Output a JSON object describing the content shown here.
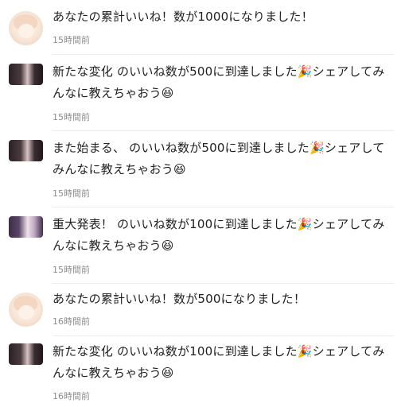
{
  "notifications": [
    {
      "text": "あなたの累計いいね！数が1000になりました！",
      "time": "15時間前"
    },
    {
      "text": "新たな変化 のいいね数が500に到達しました🎉シェアしてみんなに教えちゃおう😆",
      "time": "15時間前"
    },
    {
      "text": "また始まる、 のいいね数が500に到達しました🎉シェアしてみんなに教えちゃおう😆",
      "time": "15時間前"
    },
    {
      "text": "重大発表！ のいいね数が100に到達しました🎉シェアしてみんなに教えちゃおう😆",
      "time": "15時間前"
    },
    {
      "text": "あなたの累計いいね！数が500になりました！",
      "time": "16時間前"
    },
    {
      "text": "新たな変化 のいいね数が100に到達しました🎉シェアしてみんなに教えちゃおう😆",
      "time": "16時間前"
    }
  ]
}
